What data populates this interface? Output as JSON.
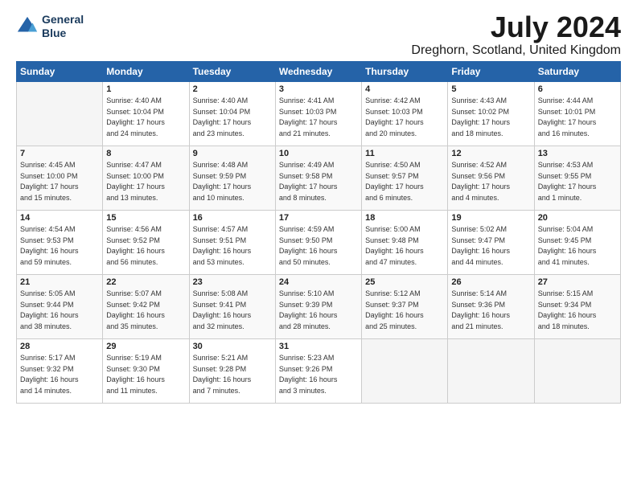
{
  "header": {
    "logo_line1": "General",
    "logo_line2": "Blue",
    "month": "July 2024",
    "location": "Dreghorn, Scotland, United Kingdom"
  },
  "days_of_week": [
    "Sunday",
    "Monday",
    "Tuesday",
    "Wednesday",
    "Thursday",
    "Friday",
    "Saturday"
  ],
  "weeks": [
    [
      {
        "day": "",
        "info": ""
      },
      {
        "day": "1",
        "info": "Sunrise: 4:40 AM\nSunset: 10:04 PM\nDaylight: 17 hours\nand 24 minutes."
      },
      {
        "day": "2",
        "info": "Sunrise: 4:40 AM\nSunset: 10:04 PM\nDaylight: 17 hours\nand 23 minutes."
      },
      {
        "day": "3",
        "info": "Sunrise: 4:41 AM\nSunset: 10:03 PM\nDaylight: 17 hours\nand 21 minutes."
      },
      {
        "day": "4",
        "info": "Sunrise: 4:42 AM\nSunset: 10:03 PM\nDaylight: 17 hours\nand 20 minutes."
      },
      {
        "day": "5",
        "info": "Sunrise: 4:43 AM\nSunset: 10:02 PM\nDaylight: 17 hours\nand 18 minutes."
      },
      {
        "day": "6",
        "info": "Sunrise: 4:44 AM\nSunset: 10:01 PM\nDaylight: 17 hours\nand 16 minutes."
      }
    ],
    [
      {
        "day": "7",
        "info": "Sunrise: 4:45 AM\nSunset: 10:00 PM\nDaylight: 17 hours\nand 15 minutes."
      },
      {
        "day": "8",
        "info": "Sunrise: 4:47 AM\nSunset: 10:00 PM\nDaylight: 17 hours\nand 13 minutes."
      },
      {
        "day": "9",
        "info": "Sunrise: 4:48 AM\nSunset: 9:59 PM\nDaylight: 17 hours\nand 10 minutes."
      },
      {
        "day": "10",
        "info": "Sunrise: 4:49 AM\nSunset: 9:58 PM\nDaylight: 17 hours\nand 8 minutes."
      },
      {
        "day": "11",
        "info": "Sunrise: 4:50 AM\nSunset: 9:57 PM\nDaylight: 17 hours\nand 6 minutes."
      },
      {
        "day": "12",
        "info": "Sunrise: 4:52 AM\nSunset: 9:56 PM\nDaylight: 17 hours\nand 4 minutes."
      },
      {
        "day": "13",
        "info": "Sunrise: 4:53 AM\nSunset: 9:55 PM\nDaylight: 17 hours\nand 1 minute."
      }
    ],
    [
      {
        "day": "14",
        "info": "Sunrise: 4:54 AM\nSunset: 9:53 PM\nDaylight: 16 hours\nand 59 minutes."
      },
      {
        "day": "15",
        "info": "Sunrise: 4:56 AM\nSunset: 9:52 PM\nDaylight: 16 hours\nand 56 minutes."
      },
      {
        "day": "16",
        "info": "Sunrise: 4:57 AM\nSunset: 9:51 PM\nDaylight: 16 hours\nand 53 minutes."
      },
      {
        "day": "17",
        "info": "Sunrise: 4:59 AM\nSunset: 9:50 PM\nDaylight: 16 hours\nand 50 minutes."
      },
      {
        "day": "18",
        "info": "Sunrise: 5:00 AM\nSunset: 9:48 PM\nDaylight: 16 hours\nand 47 minutes."
      },
      {
        "day": "19",
        "info": "Sunrise: 5:02 AM\nSunset: 9:47 PM\nDaylight: 16 hours\nand 44 minutes."
      },
      {
        "day": "20",
        "info": "Sunrise: 5:04 AM\nSunset: 9:45 PM\nDaylight: 16 hours\nand 41 minutes."
      }
    ],
    [
      {
        "day": "21",
        "info": "Sunrise: 5:05 AM\nSunset: 9:44 PM\nDaylight: 16 hours\nand 38 minutes."
      },
      {
        "day": "22",
        "info": "Sunrise: 5:07 AM\nSunset: 9:42 PM\nDaylight: 16 hours\nand 35 minutes."
      },
      {
        "day": "23",
        "info": "Sunrise: 5:08 AM\nSunset: 9:41 PM\nDaylight: 16 hours\nand 32 minutes."
      },
      {
        "day": "24",
        "info": "Sunrise: 5:10 AM\nSunset: 9:39 PM\nDaylight: 16 hours\nand 28 minutes."
      },
      {
        "day": "25",
        "info": "Sunrise: 5:12 AM\nSunset: 9:37 PM\nDaylight: 16 hours\nand 25 minutes."
      },
      {
        "day": "26",
        "info": "Sunrise: 5:14 AM\nSunset: 9:36 PM\nDaylight: 16 hours\nand 21 minutes."
      },
      {
        "day": "27",
        "info": "Sunrise: 5:15 AM\nSunset: 9:34 PM\nDaylight: 16 hours\nand 18 minutes."
      }
    ],
    [
      {
        "day": "28",
        "info": "Sunrise: 5:17 AM\nSunset: 9:32 PM\nDaylight: 16 hours\nand 14 minutes."
      },
      {
        "day": "29",
        "info": "Sunrise: 5:19 AM\nSunset: 9:30 PM\nDaylight: 16 hours\nand 11 minutes."
      },
      {
        "day": "30",
        "info": "Sunrise: 5:21 AM\nSunset: 9:28 PM\nDaylight: 16 hours\nand 7 minutes."
      },
      {
        "day": "31",
        "info": "Sunrise: 5:23 AM\nSunset: 9:26 PM\nDaylight: 16 hours\nand 3 minutes."
      },
      {
        "day": "",
        "info": ""
      },
      {
        "day": "",
        "info": ""
      },
      {
        "day": "",
        "info": ""
      }
    ]
  ]
}
